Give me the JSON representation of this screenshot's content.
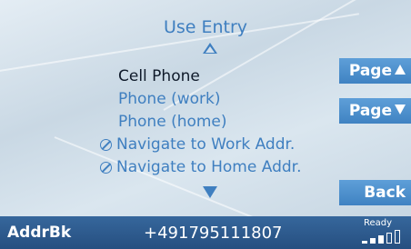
{
  "title": "Use Entry",
  "menu": {
    "items": [
      {
        "label": "Cell Phone",
        "selected": true,
        "icon": ""
      },
      {
        "label": "Phone (work)",
        "selected": false,
        "icon": ""
      },
      {
        "label": "Phone (home)",
        "selected": false,
        "icon": ""
      },
      {
        "label": "Navigate to Work Addr.",
        "selected": false,
        "icon": "navigation-icon"
      },
      {
        "label": "Navigate to Home Addr.",
        "selected": false,
        "icon": "navigation-icon"
      }
    ]
  },
  "side_buttons": {
    "page_up": "Page",
    "page_down": "Page",
    "back": "Back"
  },
  "status": {
    "source": "AddrBk",
    "number": "+491795111807",
    "ready": "Ready",
    "signal_bars_filled": 3,
    "signal_bars_total": 5
  },
  "colors": {
    "text_accent": "#3f7fc0",
    "text_selected": "#0f1a2a",
    "button_bg": "#4a8ccc",
    "statusbar_bg": "#2e5b8e"
  }
}
